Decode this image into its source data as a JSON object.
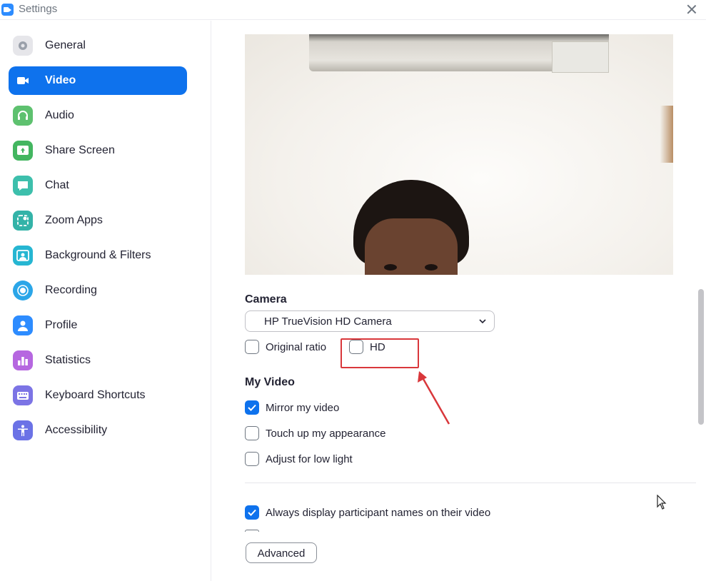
{
  "window": {
    "title": "Settings"
  },
  "icons": {
    "app": "zoom-video-icon",
    "close": "close-icon",
    "rotate": "rotate-camera-icon",
    "chevron": "chevron-down-icon",
    "cursor": "mouse-pointer-icon"
  },
  "colors": {
    "accent": "#0e72ed",
    "annotation": "#d9373b"
  },
  "sidebar": {
    "items": [
      {
        "label": "General",
        "icon": "gear-icon",
        "active": false,
        "color": "#e6e6ea"
      },
      {
        "label": "Video",
        "icon": "video-camera-icon",
        "active": true,
        "color": "#0e72ed"
      },
      {
        "label": "Audio",
        "icon": "headphones-icon",
        "active": false,
        "color": "#5ec16f"
      },
      {
        "label": "Share Screen",
        "icon": "share-screen-icon",
        "active": false,
        "color": "#43b660"
      },
      {
        "label": "Chat",
        "icon": "chat-bubble-icon",
        "active": false,
        "color": "#3dbfac"
      },
      {
        "label": "Zoom Apps",
        "icon": "zoom-apps-icon",
        "active": false,
        "color": "#33b3a8"
      },
      {
        "label": "Background & Filters",
        "icon": "background-filter-icon",
        "active": false,
        "color": "#26b6d2"
      },
      {
        "label": "Recording",
        "icon": "recording-icon",
        "active": false,
        "color": "#2ba6e8"
      },
      {
        "label": "Profile",
        "icon": "profile-icon",
        "active": false,
        "color": "#2d8cff"
      },
      {
        "label": "Statistics",
        "icon": "statistics-icon",
        "active": false,
        "color": "#b667e0"
      },
      {
        "label": "Keyboard Shortcuts",
        "icon": "keyboard-icon",
        "active": false,
        "color": "#7c74e5"
      },
      {
        "label": "Accessibility",
        "icon": "accessibility-icon",
        "active": false,
        "color": "#6b72e6"
      }
    ]
  },
  "camera": {
    "section_title": "Camera",
    "selected": "HP TrueVision HD Camera",
    "original_ratio": {
      "label": "Original ratio",
      "checked": false
    },
    "hd": {
      "label": "HD",
      "checked": false
    }
  },
  "my_video": {
    "section_title": "My Video",
    "options": [
      {
        "label": "Mirror my video",
        "checked": true
      },
      {
        "label": "Touch up my appearance",
        "checked": false
      },
      {
        "label": "Adjust for low light",
        "checked": false
      }
    ]
  },
  "more": {
    "always_display_names": {
      "label": "Always display participant names on their video",
      "checked": true
    }
  },
  "advanced_button": {
    "label": "Advanced"
  }
}
